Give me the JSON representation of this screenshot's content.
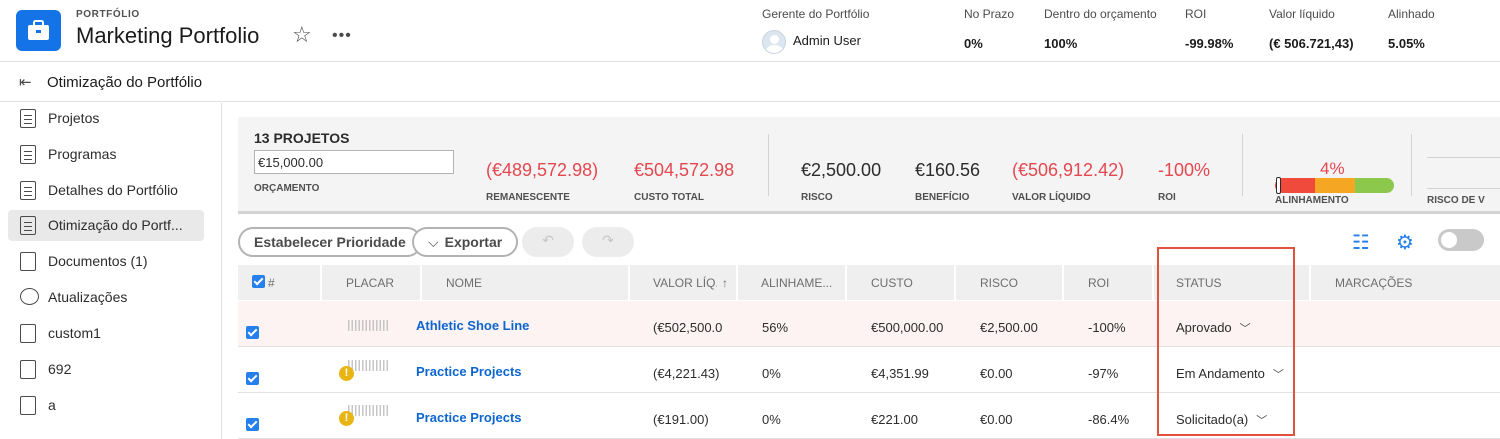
{
  "header": {
    "kicker": "PORTFÓLIO",
    "title": "Marketing Portfolio",
    "star_icon": "☆",
    "more_icon": "•••",
    "manager": {
      "label": "Gerente do Portfólio",
      "name": "Admin User"
    },
    "stats": [
      {
        "label": "No Prazo",
        "value": "0%"
      },
      {
        "label": "Dentro do orçamento",
        "value": "100%"
      },
      {
        "label": "ROI",
        "value": "-99.98%"
      },
      {
        "label": "Valor líquido",
        "value": "(€ 506.721,43)"
      },
      {
        "label": "Alinhado",
        "value": "5.05%"
      }
    ]
  },
  "subheader": {
    "back_icon": "⇤",
    "title": "Otimização do Portfólio"
  },
  "sidebar": {
    "items": [
      {
        "label": "Projetos",
        "icon": "list-icon"
      },
      {
        "label": "Programas",
        "icon": "document-icon"
      },
      {
        "label": "Detalhes do Portfólio",
        "icon": "document-icon"
      },
      {
        "label": "Otimização do Portf...",
        "icon": "optimization-icon",
        "active": true
      },
      {
        "label": "Documentos (1)",
        "icon": "file-icon"
      },
      {
        "label": "Atualizações",
        "icon": "chat-icon"
      },
      {
        "label": "custom1",
        "icon": "custom-icon"
      },
      {
        "label": "692",
        "icon": "custom-icon"
      },
      {
        "label": "a",
        "icon": "custom-icon"
      }
    ]
  },
  "summary": {
    "project_count": "13 PROJETOS",
    "budget_value": "€15,000.00",
    "budget_label": "ORÇAMENTO",
    "metrics": [
      {
        "value": "(€489,572.98)",
        "label": "REMANESCENTE",
        "negative": true
      },
      {
        "value": "€504,572.98",
        "label": "CUSTO TOTAL",
        "negative": true
      },
      {
        "value": "€2,500.00",
        "label": "RISCO",
        "negative": false
      },
      {
        "value": "€160.56",
        "label": "BENEFÍCIO",
        "negative": false
      },
      {
        "value": "(€506,912.42)",
        "label": "VALOR LÍQUIDO",
        "negative": true
      },
      {
        "value": "-100%",
        "label": "ROI",
        "negative": true
      }
    ],
    "alignment": {
      "value": "4%",
      "label": "ALINHAMENTO",
      "segments": [
        "#ef4a3c",
        "#f5a623",
        "#8cc84b"
      ]
    },
    "risk_label": "RISCO DE V"
  },
  "toolbar": {
    "prioritize_label": "Estabelecer Prioridade",
    "export_label": "Exportar",
    "export_chevron": "⌵",
    "undo_icon": "↶",
    "redo_icon": "↷",
    "filter_icon": "☷",
    "settings_icon": "⚙"
  },
  "table": {
    "columns": [
      "#",
      "PLACAR",
      "NOME",
      "VALOR LÍQ...",
      "ALINHAME...",
      "CUSTO",
      "RISCO",
      "ROI",
      "STATUS",
      "MARCAÇÕES"
    ],
    "sort_icon": "↑",
    "rows": [
      {
        "warning": false,
        "name": "Athletic Shoe Line",
        "net_value": "(€502,500.0",
        "alignment": "56%",
        "cost": "€500,000.00",
        "risk": "€2,500.00",
        "roi": "-100%",
        "status": "Aprovado"
      },
      {
        "warning": true,
        "name": "Practice Projects",
        "net_value": "(€4,221.43)",
        "alignment": "0%",
        "cost": "€4,351.99",
        "risk": "€0.00",
        "roi": "-97%",
        "status": "Em Andamento"
      },
      {
        "warning": true,
        "name": "Practice Projects",
        "net_value": "(€191.00)",
        "alignment": "0%",
        "cost": "€221.00",
        "risk": "€0.00",
        "roi": "-86.4%",
        "status": "Solicitado(a)"
      }
    ]
  }
}
